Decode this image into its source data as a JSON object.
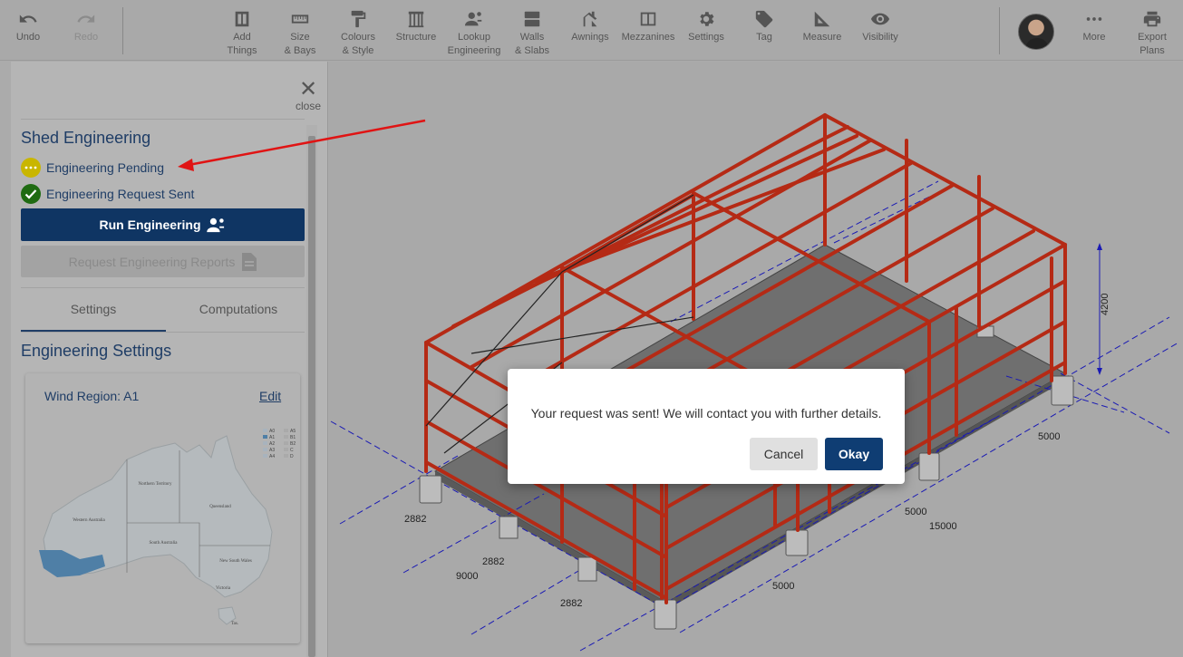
{
  "toolbar": {
    "undo": "Undo",
    "redo": "Redo",
    "items": [
      {
        "label": "Add\nThings"
      },
      {
        "label": "Size\n& Bays"
      },
      {
        "label": "Colours\n& Style"
      },
      {
        "label": "Structure"
      },
      {
        "label": "Lookup\nEngineering"
      },
      {
        "label": "Walls\n& Slabs"
      },
      {
        "label": "Awnings"
      },
      {
        "label": "Mezzanines"
      },
      {
        "label": "Settings"
      },
      {
        "label": "Tag"
      },
      {
        "label": "Measure"
      },
      {
        "label": "Visibility"
      }
    ],
    "more": "More",
    "export": "Export\nPlans"
  },
  "sidebar": {
    "close": "close",
    "section_title": "Shed Engineering",
    "status_pending": "Engineering Pending",
    "status_sent": "Engineering Request Sent",
    "run_button": "Run Engineering",
    "request_button": "Request Engineering Reports",
    "tabs": [
      "Settings",
      "Computations"
    ],
    "settings_title": "Engineering Settings",
    "wind_region": "Wind Region: A1",
    "edit": "Edit",
    "legend": [
      "A0",
      "A1",
      "A2",
      "A3",
      "A4",
      "A5",
      "B1",
      "B2",
      "C",
      "D"
    ],
    "map_labels": [
      "Northern Territory",
      "Queensland",
      "Western Australia",
      "South Australia",
      "New South Wales",
      "Victoria",
      "Tas."
    ]
  },
  "dimensions": [
    "4200",
    "5000",
    "5000",
    "15000",
    "5000",
    "2882",
    "2882",
    "9000",
    "2882"
  ],
  "modal": {
    "message": "Your request was sent! We will contact you with further details.",
    "cancel": "Cancel",
    "okay": "Okay"
  },
  "colors": {
    "brand_navy": "#0f3563",
    "frame_red": "#b52a15",
    "pending_yellow": "#c9b600",
    "sent_green": "#1f6b12"
  }
}
